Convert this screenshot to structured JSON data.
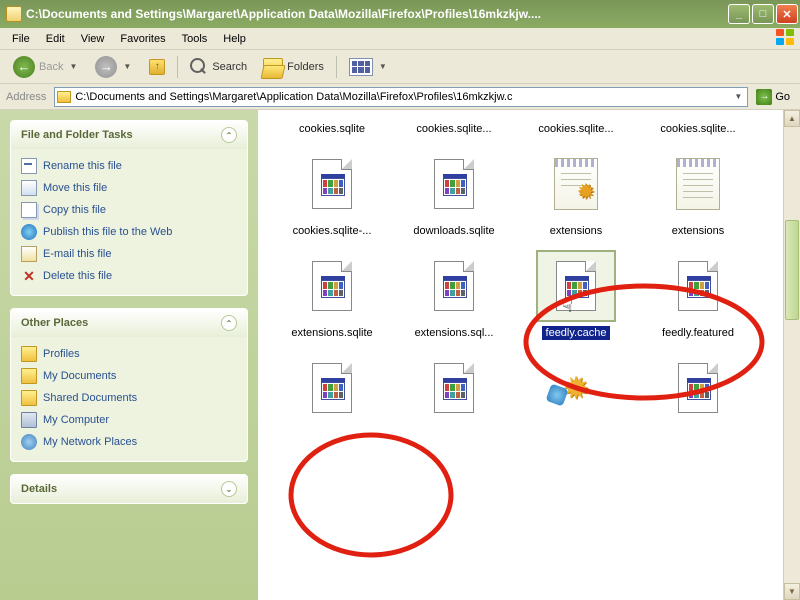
{
  "window": {
    "title": "C:\\Documents and Settings\\Margaret\\Application Data\\Mozilla\\Firefox\\Profiles\\16mkzkjw...."
  },
  "menu": {
    "file": "File",
    "edit": "Edit",
    "view": "View",
    "favorites": "Favorites",
    "tools": "Tools",
    "help": "Help"
  },
  "toolbar": {
    "back": "Back",
    "search": "Search",
    "folders": "Folders"
  },
  "address": {
    "label": "Address",
    "path": "C:\\Documents and Settings\\Margaret\\Application Data\\Mozilla\\Firefox\\Profiles\\16mkzkjw.c",
    "go": "Go"
  },
  "panels": {
    "tasks": {
      "title": "File and Folder Tasks",
      "items": [
        "Rename this file",
        "Move this file",
        "Copy this file",
        "Publish this file to the Web",
        "E-mail this file",
        "Delete this file"
      ]
    },
    "places": {
      "title": "Other Places",
      "items": [
        "Profiles",
        "My Documents",
        "Shared Documents",
        "My Computer",
        "My Network Places"
      ]
    },
    "details": {
      "title": "Details"
    }
  },
  "files": [
    {
      "name": "cookies.sqlite",
      "type": "doc"
    },
    {
      "name": "cookies.sqlite...",
      "type": "doc"
    },
    {
      "name": "cookies.sqlite...",
      "type": "doc"
    },
    {
      "name": "cookies.sqlite...",
      "type": "doc"
    },
    {
      "name": "cookies.sqlite-...",
      "type": "doc"
    },
    {
      "name": "downloads.sqlite",
      "type": "doc"
    },
    {
      "name": "extensions",
      "type": "notegear"
    },
    {
      "name": "extensions",
      "type": "note"
    },
    {
      "name": "extensions.sqlite",
      "type": "doc"
    },
    {
      "name": "extensions.sql...",
      "type": "doc"
    },
    {
      "name": "feedly.cache",
      "type": "doc",
      "selected": true
    },
    {
      "name": "feedly.featured",
      "type": "doc"
    },
    {
      "name": "",
      "type": "doc"
    },
    {
      "name": "",
      "type": "doc"
    },
    {
      "name": "",
      "type": "ext"
    },
    {
      "name": "",
      "type": "doc"
    }
  ]
}
